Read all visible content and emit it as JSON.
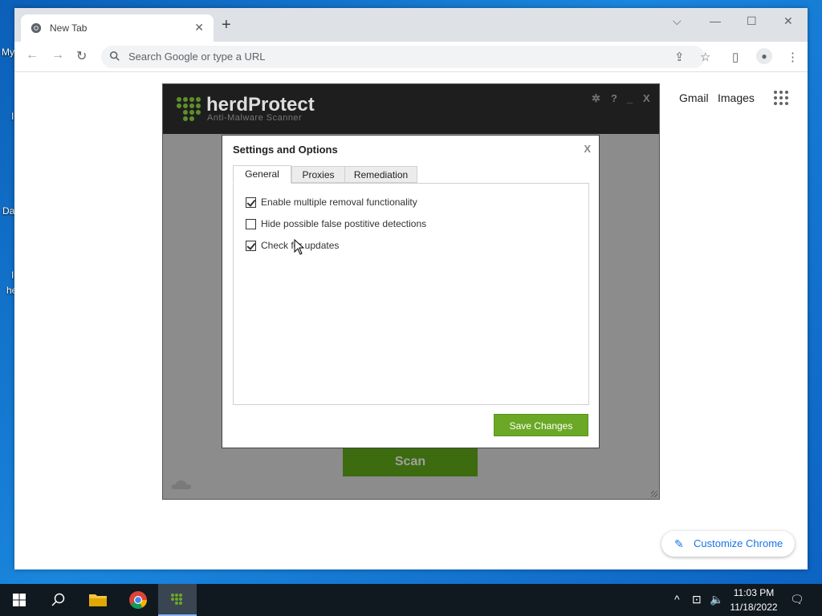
{
  "desktop": {
    "icon_labels": [
      "My",
      "I",
      "Da",
      "I",
      "he"
    ]
  },
  "browser": {
    "tab": {
      "title": "New Tab",
      "close": "✕"
    },
    "newtab": "+",
    "window_controls": {
      "dropdown": "⌵",
      "minimize": "—",
      "maximize": "☐",
      "close": "✕"
    },
    "omnibox": {
      "placeholder": "Search Google or type a URL"
    },
    "ntp": {
      "gmail": "Gmail",
      "images": "Images",
      "customize": "Customize Chrome"
    }
  },
  "herdprotect": {
    "name": "herdProtect",
    "tagline": "Anti-Malware Scanner",
    "controls": {
      "settings": "✲",
      "help": "?",
      "minimize": "_",
      "close": "X"
    },
    "scan_label": "Scan"
  },
  "dialog": {
    "title": "Settings and Options",
    "close": "X",
    "tabs": [
      {
        "label": "General",
        "active": true
      },
      {
        "label": "Proxies",
        "active": false
      },
      {
        "label": "Remediation",
        "active": false
      }
    ],
    "options": [
      {
        "label": "Enable multiple removal functionality",
        "checked": true
      },
      {
        "label": "Hide possible false postitive detections",
        "checked": false
      },
      {
        "label": "Check for updates",
        "checked": true
      }
    ],
    "save_label": "Save Changes"
  },
  "taskbar": {
    "time": "11:03 PM",
    "date": "11/18/2022",
    "apps": [
      "start",
      "search",
      "file-explorer",
      "chrome",
      "herdprotect"
    ]
  },
  "colors": {
    "save_green": "#6ba825",
    "scan_green": "#3d6b10",
    "chrome_blue": "#1a73e8",
    "taskbar": "#101820"
  }
}
